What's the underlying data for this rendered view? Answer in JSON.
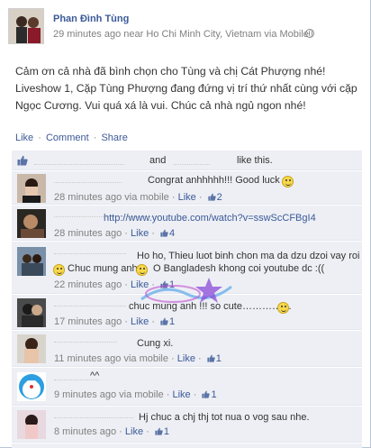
{
  "post": {
    "author": "Phan Đình Tùng",
    "meta": "29 minutes ago near Ho Chi Minh City, Vietnam via Mobile",
    "text": "Cảm ơn cả nhà đã bình chọn cho Tùng và chị Cát Phượng nhé! Liveshow 1, Cặp Tùng Phượng đang đứng vị trí thứ nhất cùng với cặp Ngọc Cương. Vui quá xá là vui. Chúc cả nhà ngủ ngon nhé!",
    "actions": {
      "like": "Like",
      "comment": "Comment",
      "share": "Share",
      "sep": "·"
    }
  },
  "likes": {
    "and": "and",
    "tail": "like this."
  },
  "comments": [
    {
      "text": "Congrat anhhhhh!!! Good luck",
      "time": "28 minutes ago via mobile",
      "like": "Like",
      "count": "2"
    },
    {
      "text": "http://www.youtube.com/watch?v=sswScCFBgI4",
      "time": "28 minutes ago",
      "like": "Like",
      "count": "4"
    },
    {
      "text1": "Ho ho, Thieu luot binh chon ma da dzu dzoi vay roi",
      "text2": "Chuc mung anh",
      "text3": "O Banglad",
      "text3b": "esh khong coi youtube dc :((",
      "time": "22 minutes ago",
      "like": "Like",
      "count": "1"
    },
    {
      "text": "chuc mung anh !!! so cute……………",
      "time": "17 minutes ago",
      "like": "Like",
      "count": "1"
    },
    {
      "text": "Cung xi.",
      "time": "11 minutes ago via mobile",
      "like": "Like",
      "count": "1"
    },
    {
      "text": "^^",
      "time": "9 minutes ago via mobile",
      "like": "Like",
      "count": "1"
    },
    {
      "text": "Hj chuc a chj thj tot nua o vog sau nhe.",
      "time": "8 minutes ago",
      "like": "Like",
      "count": "1"
    }
  ],
  "sep": "·"
}
